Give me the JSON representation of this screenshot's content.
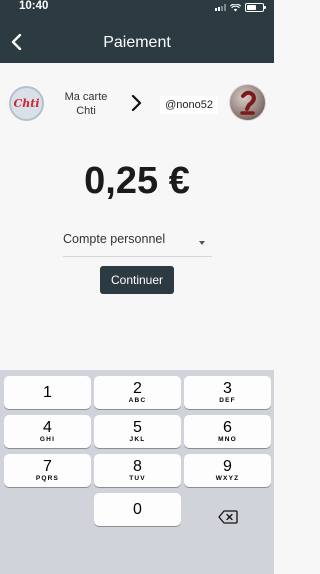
{
  "status_bar": {
    "time": "10:40",
    "battery_level": 0.6
  },
  "header": {
    "title": "Paiement"
  },
  "card": {
    "label": "Ma carte Chti",
    "logo_text": "Chti"
  },
  "recipient": {
    "name": "@nono52"
  },
  "amount": "0,25 €",
  "account": {
    "selected": "Compte personnel"
  },
  "continue_label": "Continuer",
  "keypad": {
    "keys": [
      {
        "digit": "1",
        "letters": ""
      },
      {
        "digit": "2",
        "letters": "ABC"
      },
      {
        "digit": "3",
        "letters": "DEF"
      },
      {
        "digit": "4",
        "letters": "GHI"
      },
      {
        "digit": "5",
        "letters": "JKL"
      },
      {
        "digit": "6",
        "letters": "MNO"
      },
      {
        "digit": "7",
        "letters": "PQRS"
      },
      {
        "digit": "8",
        "letters": "TUV"
      },
      {
        "digit": "9",
        "letters": "WXYZ"
      },
      {
        "digit": "0",
        "letters": ""
      }
    ]
  },
  "colors": {
    "header": "#2c3a42",
    "button": "#2c3a42",
    "keyboard": "#d0d3d9"
  }
}
